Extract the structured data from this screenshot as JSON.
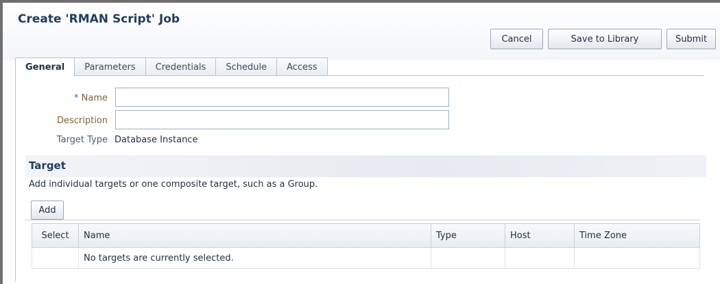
{
  "page": {
    "title": "Create 'RMAN Script' Job"
  },
  "actions": {
    "cancel_label": "Cancel",
    "save_label": "Save to Library",
    "submit_label": "Submit"
  },
  "tabs": [
    {
      "label": "General",
      "active": true
    },
    {
      "label": "Parameters",
      "active": false
    },
    {
      "label": "Credentials",
      "active": false
    },
    {
      "label": "Schedule",
      "active": false
    },
    {
      "label": "Access",
      "active": false
    }
  ],
  "form": {
    "name": {
      "required_mark": "*",
      "label": "Name",
      "value": ""
    },
    "description": {
      "label": "Description",
      "value": ""
    },
    "target_type": {
      "label": "Target Type",
      "value": "Database Instance"
    }
  },
  "target": {
    "title": "Target",
    "description": "Add individual targets or one composite target, such as a Group.",
    "add_label": "Add",
    "columns": [
      "Select",
      "Name",
      "Type",
      "Host",
      "Time Zone"
    ],
    "empty_message": "No targets are currently selected."
  },
  "colors": {
    "title_blue": "#233d5e",
    "label_brown": "#80603d",
    "border": "#b7c2cf"
  }
}
